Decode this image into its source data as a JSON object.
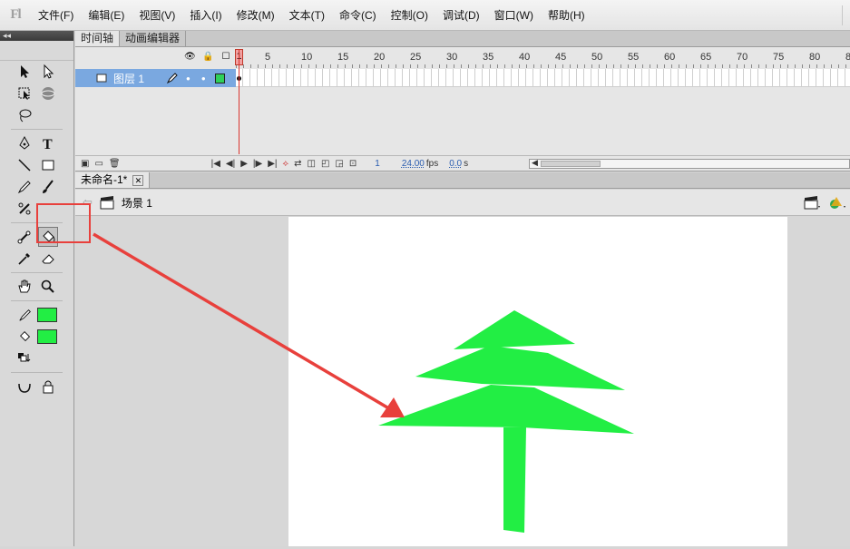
{
  "app": {
    "logo": "Fl"
  },
  "menu": [
    "文件(F)",
    "编辑(E)",
    "视图(V)",
    "插入(I)",
    "修改(M)",
    "文本(T)",
    "命令(C)",
    "控制(O)",
    "调试(D)",
    "窗口(W)",
    "帮助(H)"
  ],
  "tools": {
    "collapse_glyph": "◂◂",
    "stroke_color": "#22ee44",
    "fill_color": "#22ee44"
  },
  "timeline": {
    "tabs": [
      "时间轴",
      "动画编辑器"
    ],
    "frame_numbers": [
      "1",
      "5",
      "10",
      "15",
      "20",
      "25",
      "30",
      "35",
      "40",
      "45",
      "50",
      "55",
      "60",
      "65",
      "70",
      "75",
      "80",
      "8"
    ],
    "layer": {
      "name": "图层 1"
    },
    "current_frame": "1",
    "fps": "24.00",
    "fps_unit": "fps",
    "time": "0.0",
    "time_unit": "s"
  },
  "document": {
    "tab_title": "未命名-1*",
    "scene": "场景 1"
  },
  "colors": {
    "annotation": "#e8403c",
    "tree": "#22ee44"
  }
}
